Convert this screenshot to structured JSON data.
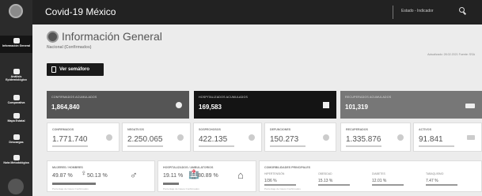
{
  "app": {
    "title": "Covid-19 México"
  },
  "topbar": {
    "search_label": "Estado - Indicador",
    "search_icon": "search-icon"
  },
  "sidebar": {
    "items": [
      {
        "label": "Información General",
        "icon": "info-icon"
      },
      {
        "label": "Análisis Epidemiológico",
        "icon": "analysis-icon"
      },
      {
        "label": "Comparativa",
        "icon": "compare-icon"
      },
      {
        "label": "Mapa Estatal",
        "icon": "map-icon"
      },
      {
        "label": "Descargas",
        "icon": "download-icon"
      },
      {
        "label": "Nota Metodológica",
        "icon": "note-icon"
      }
    ]
  },
  "header": {
    "title": "Información General",
    "subtitle": "Nacional (Confirmados)",
    "update": "Actualizado: 28.02.2021 Fuente: SSA",
    "semaforo_label": "Ver semáforo"
  },
  "top_cards": {
    "confirmados": {
      "label": "CONFIRMADOS ACUMULADOS",
      "value": "1,864,840"
    },
    "hospitalizados": {
      "label": "HOSPITALIZADOS ACUMULADOS",
      "value": "169,583"
    },
    "recuperados": {
      "label": "RECUPERADOS ACUMULADOS",
      "value": "101,319"
    }
  },
  "mid_cards": {
    "confirmados": {
      "label": "CONFIRMADOS",
      "value": "1.771.740"
    },
    "negativos": {
      "label": "NEGATIVOS",
      "value": "2.250.065"
    },
    "sospechosos": {
      "label": "SOSPECHOSOS",
      "value": "422.135"
    },
    "defunciones": {
      "label": "DEFUNCIONES",
      "value": "150.273"
    },
    "recuperados": {
      "label": "RECUPERADOS",
      "value": "1.335.876"
    },
    "activos": {
      "label": "ACTIVOS",
      "value": "91.841"
    }
  },
  "bottom": {
    "sexo": {
      "label": "MUJERES / HOMBRES",
      "female_pct": "49.87 %",
      "male_pct": "50.13 %",
      "note": "Porcentaje de Casos Confirmados",
      "female_frac": 0.4987
    },
    "hosp": {
      "label": "HOSPITALIZADOS / AMBULATORIOS",
      "hosp_pct": "19.11 %",
      "amb_pct": "80.89 %",
      "note": "Porcentaje de Casos Confirmados",
      "hosp_frac": 0.1911
    },
    "comorb": {
      "label": "COMORBILIDADES PRINCIPALES",
      "items": [
        {
          "name": "HIPERTENSIÓN",
          "value": "1/36 %"
        },
        {
          "name": "OBESIDAD",
          "value": "15.13 %"
        },
        {
          "name": "DIABETES",
          "value": "12.01 %"
        },
        {
          "name": "TABAQUISMO",
          "value": "7.47 %"
        }
      ],
      "note": "Porcentaje de Casos Confirmados"
    }
  }
}
